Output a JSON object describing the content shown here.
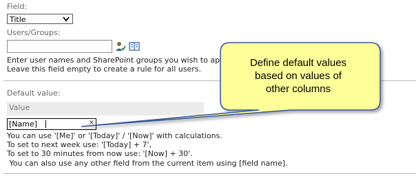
{
  "field": {
    "label": "Field:",
    "selected": "Title"
  },
  "users": {
    "label": "Users/Groups:",
    "value": "",
    "help_line1": "Enter user names and SharePoint groups you wish to apply this ru",
    "help_line2": "Leave this field empty to create a rule for all users.",
    "check_names_icon": "check-names-icon",
    "browse_icon": "address-book-icon"
  },
  "default_value": {
    "label": "Default value:",
    "column_header": "Value",
    "input_value": "[Name]",
    "clear_glyph": "×",
    "help": [
      "You can use '[Me]' or '[Today]' / '[Now]' with calculations.",
      "To set to next week use: '[Today] + 7',",
      "To set to 30 minutes from now use: '[Now] + 30'.",
      " You can also use any other field from the current item using [field name]."
    ]
  },
  "callout": {
    "text_line1": "Define default values",
    "text_line2": "based on values of",
    "text_line3": "other columns",
    "fill_color": "#ffff99",
    "border_color": "#3a5a9a"
  }
}
